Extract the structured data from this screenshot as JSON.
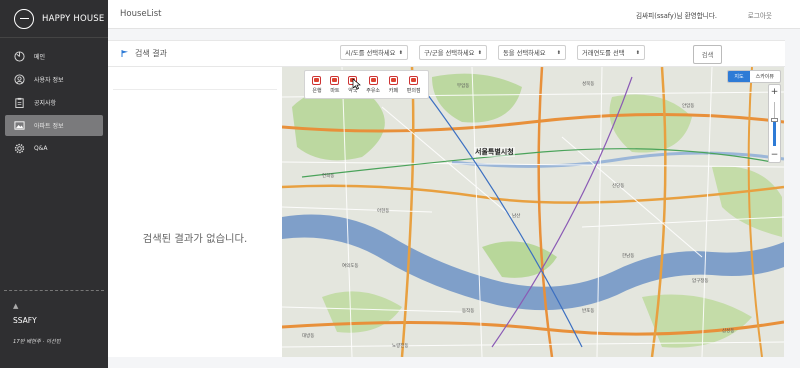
{
  "brand": {
    "name": "HAPPY HOUSE"
  },
  "sidebar": {
    "items": [
      {
        "label": "메인",
        "icon": "dashboard-icon",
        "active": false
      },
      {
        "label": "사용자 정보",
        "icon": "user-icon",
        "active": false
      },
      {
        "label": "공지사항",
        "icon": "clipboard-icon",
        "active": false
      },
      {
        "label": "아파트 정보",
        "icon": "image-icon",
        "active": true
      },
      {
        "label": "Q&A",
        "icon": "gear-icon",
        "active": false
      }
    ],
    "footer": {
      "icon": "triangle-icon",
      "brand": "SSAFY",
      "credit": "17반 배현주 · 이선민"
    }
  },
  "topbar": {
    "title": "HouseList",
    "welcome": "김싸피(ssafy)님 환영합니다.",
    "logout": "로그아웃"
  },
  "results": {
    "title": "검색 결과",
    "flag_icon": "flag-icon",
    "empty_message": "검색된 결과가 없습니다."
  },
  "filters": {
    "sido": "시/도를 선택하세요",
    "gugun": "구/군을 선택하세요",
    "dong": "동을 선택하세요",
    "year": "거래연도를 선택",
    "search_button": "검색"
  },
  "map": {
    "categories": [
      "은행",
      "마트",
      "약국",
      "주유소",
      "카페",
      "편의점"
    ],
    "map_type": [
      "지도",
      "스카이뷰"
    ],
    "selected_map_type": "지도",
    "zoom_in": "+",
    "zoom_out": "−",
    "city_hall_label": "서울특별시청",
    "colors": {
      "accent": "#2e7bd6",
      "river": "#7f9fc9",
      "major_road": "#e8903a",
      "park": "#b8d79a"
    }
  }
}
